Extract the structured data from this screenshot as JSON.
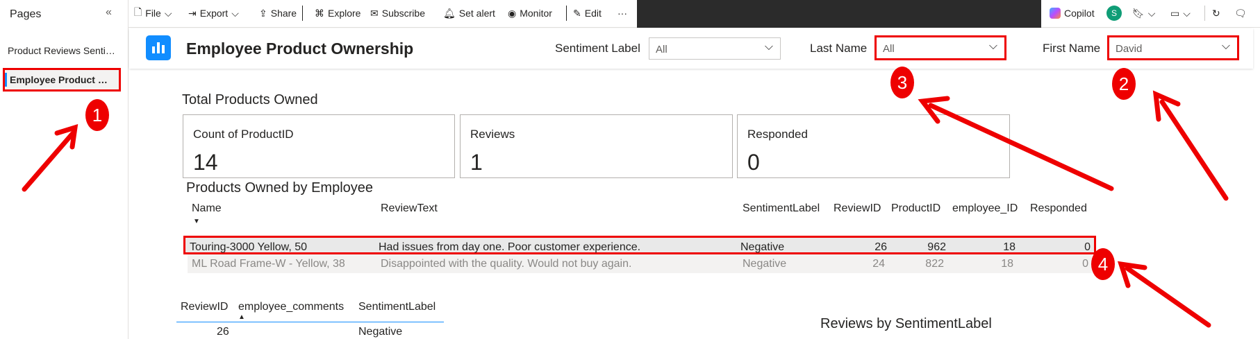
{
  "pages_pane": {
    "title": "Pages",
    "collapse_glyph": "«",
    "items": [
      {
        "label": "Product Reviews Sentim..."
      },
      {
        "label": "Employee Product Ow..."
      }
    ]
  },
  "toolbar": {
    "file": "File",
    "export": "Export",
    "share": "Share",
    "explore": "Explore",
    "subscribe": "Subscribe",
    "set_alert": "Set alert",
    "monitor": "Monitor",
    "edit": "Edit",
    "more": "···",
    "copilot": "Copilot",
    "avatar_letter": "S"
  },
  "report": {
    "title": "Employee Product Ownership",
    "slicers": [
      {
        "label": "Sentiment Label",
        "value": "All"
      },
      {
        "label": "Last Name",
        "value": "All"
      },
      {
        "label": "First Name",
        "value": "David"
      }
    ]
  },
  "cards_section": {
    "title": "Total Products Owned",
    "cards": [
      {
        "label": "Count of ProductID",
        "value": "14"
      },
      {
        "label": "Reviews",
        "value": "1"
      },
      {
        "label": "Responded",
        "value": "0"
      }
    ]
  },
  "table": {
    "title": "Products Owned by Employee",
    "columns": [
      "Name",
      "ReviewText",
      "SentimentLabel",
      "ReviewID",
      "ProductID",
      "employee_ID",
      "Responded"
    ],
    "rows": [
      [
        "Touring-3000 Yellow, 50",
        "Had issues from day one. Poor customer experience.",
        "Negative",
        "26",
        "962",
        "18",
        "0"
      ],
      [
        "ML Road Frame-W - Yellow, 38",
        "Disappointed with the quality. Would not buy again.",
        "Negative",
        "24",
        "822",
        "18",
        "0"
      ]
    ]
  },
  "bottom_table": {
    "columns": [
      "ReviewID",
      "employee_comments",
      "SentimentLabel"
    ],
    "row": [
      "26",
      "",
      "Negative"
    ]
  },
  "chart": {
    "title": "Reviews by SentimentLabel"
  },
  "annotations": [
    "1",
    "2",
    "3",
    "4"
  ],
  "colors": {
    "accent": "#118dff",
    "highlight": "#e00000",
    "dark_band": "#2b2b2b"
  }
}
